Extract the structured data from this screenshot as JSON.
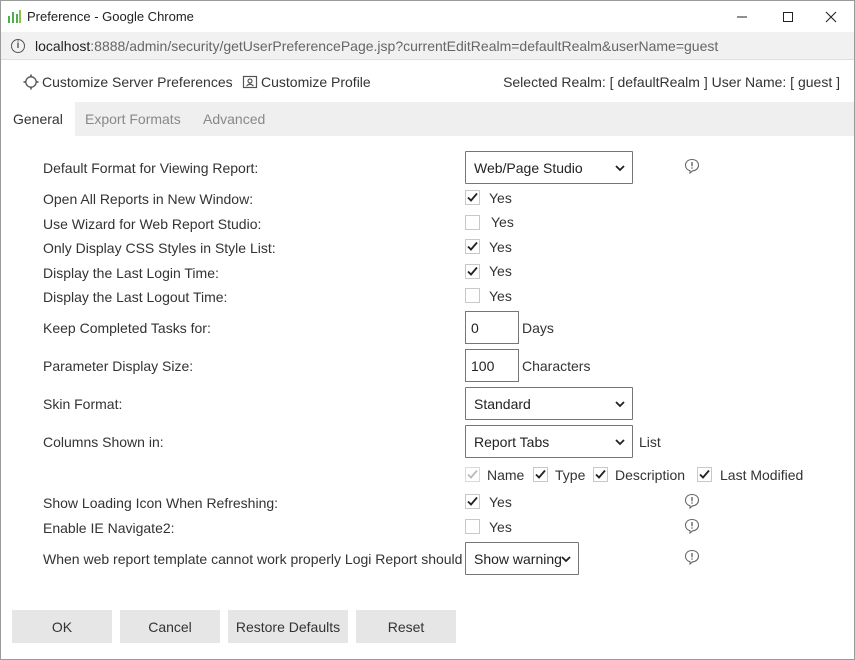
{
  "window": {
    "title": "Preference - Google Chrome",
    "minimize_glyph": "—",
    "maximize_glyph": "☐",
    "close_glyph": "✕"
  },
  "address": {
    "host": "localhost",
    "rest": ":8888/admin/security/getUserPreferencePage.jsp?currentEditRealm=defaultRealm&userName=guest"
  },
  "toolbar": {
    "customize_server_label": "Customize Server Preferences",
    "customize_profile_label": "Customize Profile",
    "realm_info": "Selected Realm: [ defaultRealm ]  User Name: [ guest ]"
  },
  "tabs": [
    {
      "label": "General",
      "active": true
    },
    {
      "label": "Export Formats",
      "active": false
    },
    {
      "label": "Advanced",
      "active": false
    }
  ],
  "form": {
    "default_format": {
      "label": "Default Format for Viewing Report:",
      "value": "Web/Page Studio"
    },
    "open_new_window": {
      "label": "Open All Reports in New Window:",
      "checked": true,
      "option": "Yes"
    },
    "use_wizard": {
      "label": "Use Wizard for Web Report Studio:",
      "checked": false,
      "option": "Yes"
    },
    "only_css": {
      "label": "Only Display CSS Styles in Style List:",
      "checked": true,
      "option": "Yes"
    },
    "last_login": {
      "label": "Display the Last Login Time:",
      "checked": true,
      "option": "Yes"
    },
    "last_logout": {
      "label": "Display the Last Logout Time:",
      "checked": false,
      "option": "Yes"
    },
    "keep_tasks": {
      "label": "Keep Completed Tasks for:",
      "value": "0",
      "unit": "Days"
    },
    "param_size": {
      "label": "Parameter Display Size:",
      "value": "100",
      "unit": "Characters"
    },
    "skin_format": {
      "label": "Skin Format:",
      "value": "Standard"
    },
    "columns_shown": {
      "label": "Columns Shown in:",
      "value": "Report Tabs",
      "unit": "List"
    },
    "columns": [
      {
        "label": "Name",
        "checked": true,
        "disabled": true
      },
      {
        "label": "Type",
        "checked": true,
        "disabled": false
      },
      {
        "label": "Description",
        "checked": true,
        "disabled": false
      },
      {
        "label": "Last Modified",
        "checked": true,
        "disabled": false
      }
    ],
    "loading_icon": {
      "label": "Show Loading Icon When Refreshing:",
      "checked": true,
      "option": "Yes"
    },
    "ie_navigate": {
      "label": "Enable IE Navigate2:",
      "checked": false,
      "option": "Yes"
    },
    "template_warning": {
      "label": "When web report template cannot work properly Logi Report should",
      "value": "Show warning"
    }
  },
  "buttons": {
    "ok": "OK",
    "cancel": "Cancel",
    "restore": "Restore Defaults",
    "reset": "Reset"
  },
  "colors": {
    "tab_strip": "#efefef",
    "button_bg": "#e6e6e6",
    "app_icon_green": "#4caf50"
  }
}
